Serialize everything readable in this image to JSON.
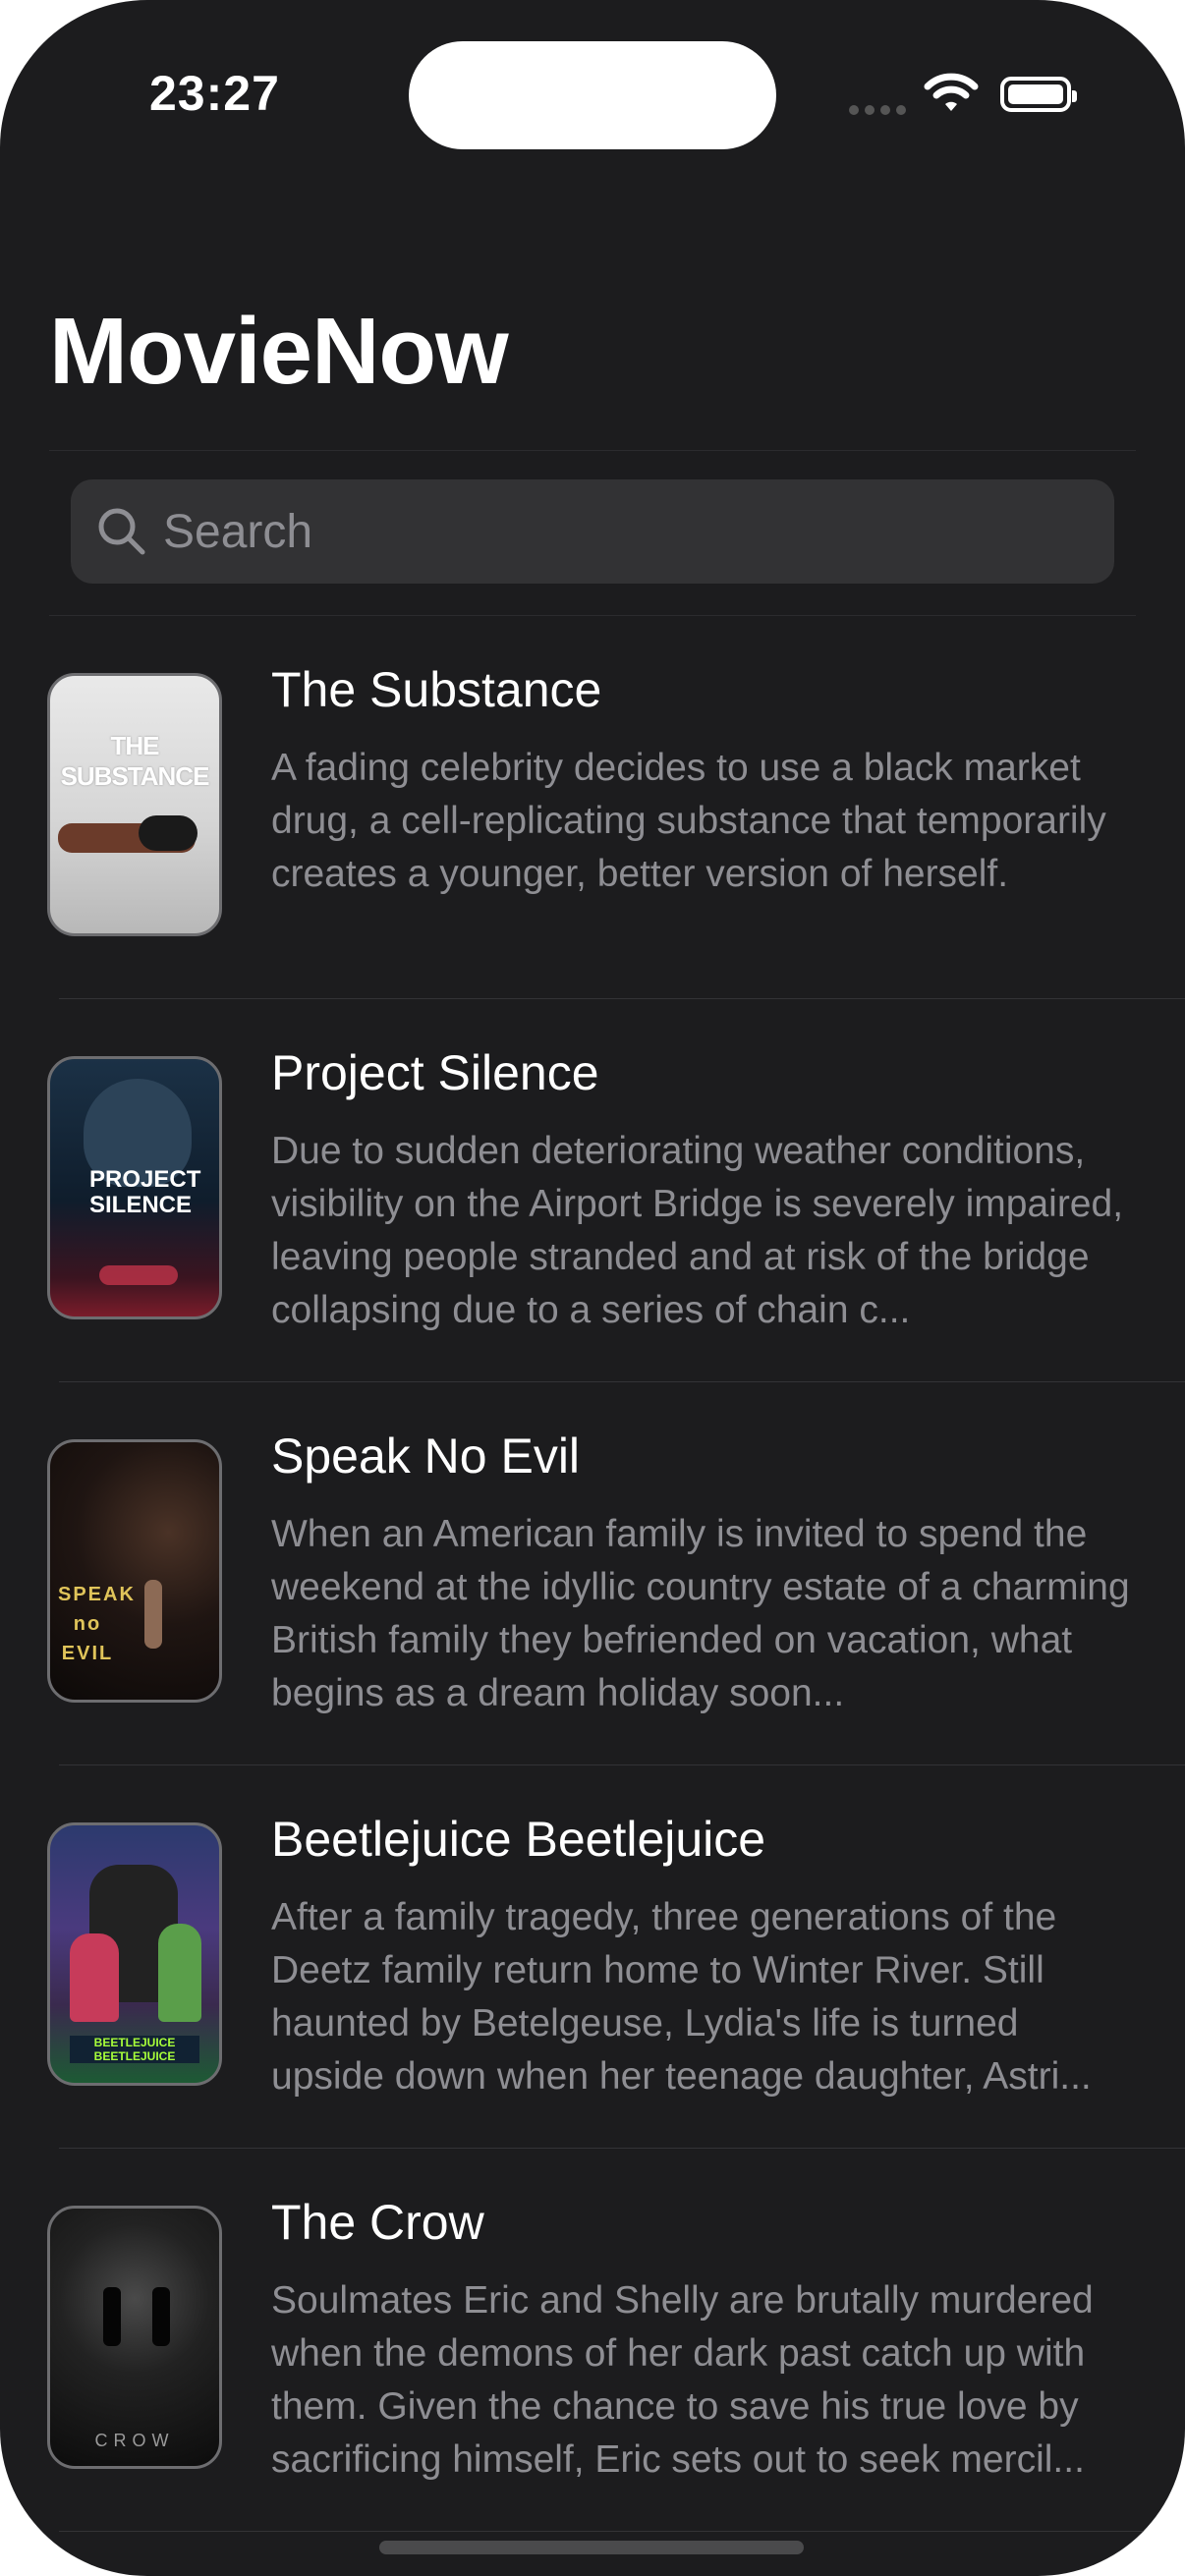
{
  "status": {
    "time": "23:27"
  },
  "app": {
    "title": "MovieNow"
  },
  "search": {
    "placeholder": "Search"
  },
  "movies": [
    {
      "title": "The Substance",
      "description": "A fading celebrity decides to use a black market drug, a cell-replicating substance that temporarily creates a younger, better version of herself.",
      "poster_text": "THE SUBSTANCE"
    },
    {
      "title": "Project Silence",
      "description": "Due to sudden deteriorating weather conditions, visibility on the Airport Bridge is severely impaired, leaving people stranded and at risk of the bridge collapsing due to a series of chain c...",
      "poster_text": "PROJECT SILENCE"
    },
    {
      "title": "Speak No Evil",
      "description": "When an American family is invited to spend the weekend at the idyllic country estate of a charming British family they befriended on vacation, what begins as a dream holiday soon...",
      "poster_text": "SPEAK no EVIL"
    },
    {
      "title": "Beetlejuice Beetlejuice",
      "description": "After a family tragedy, three generations of the Deetz family return home to Winter River. Still haunted by Betelgeuse, Lydia's life is turned upside down when her teenage daughter, Astri...",
      "poster_text": "BEETLEJUICE BEETLEJUICE"
    },
    {
      "title": "The Crow",
      "description": "Soulmates Eric and Shelly are brutally murdered when the demons of her dark past catch up with them. Given the chance to save his true love by sacrificing himself, Eric sets out to seek mercil...",
      "poster_text": "CROW"
    }
  ],
  "colors": {
    "background": "#1c1c1e",
    "search_field": "#323234",
    "secondary_text": "#8e8e93"
  }
}
